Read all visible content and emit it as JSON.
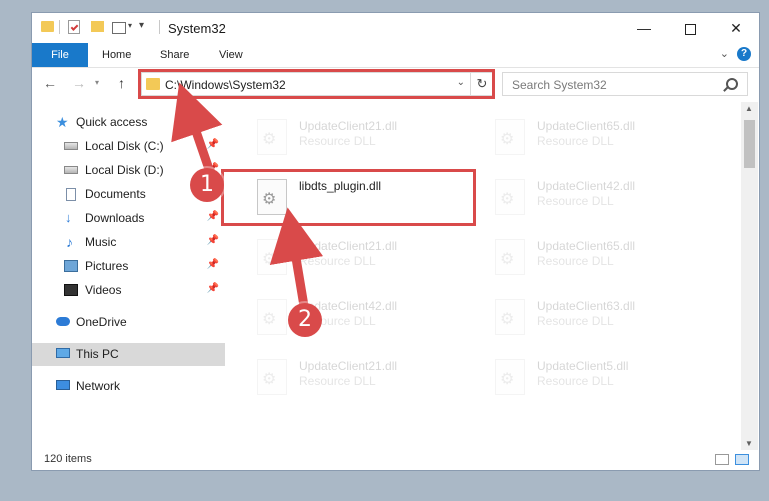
{
  "window": {
    "title": "System32"
  },
  "ribbon": {
    "file": "File",
    "home": "Home",
    "share": "Share",
    "view": "View"
  },
  "address": {
    "path": "C:\\Windows\\System32"
  },
  "search": {
    "placeholder": "Search System32"
  },
  "sidebar": {
    "items": [
      {
        "label": "Quick access",
        "icon": "star-icon",
        "pinned": false
      },
      {
        "label": "Local Disk (C:)",
        "icon": "drive-icon",
        "pinned": true
      },
      {
        "label": "Local Disk (D:)",
        "icon": "drive-icon",
        "pinned": true
      },
      {
        "label": "Documents",
        "icon": "documents-icon",
        "pinned": true
      },
      {
        "label": "Downloads",
        "icon": "downloads-icon",
        "pinned": true
      },
      {
        "label": "Music",
        "icon": "music-icon",
        "pinned": true
      },
      {
        "label": "Pictures",
        "icon": "pictures-icon",
        "pinned": true
      },
      {
        "label": "Videos",
        "icon": "videos-icon",
        "pinned": true
      },
      {
        "label": "OneDrive",
        "icon": "onedrive-icon",
        "pinned": false
      },
      {
        "label": "This PC",
        "icon": "this-pc-icon",
        "pinned": false,
        "selected": true
      },
      {
        "label": "Network",
        "icon": "network-icon",
        "pinned": false
      }
    ]
  },
  "files": {
    "left": [
      {
        "name": "UpdateClient21.dll",
        "type": "Resource DLL"
      },
      {
        "name": "libdts_plugin.dll",
        "type": ""
      },
      {
        "name": "UpdateClient21.dll",
        "type": "Resource DLL"
      },
      {
        "name": "UpdateClient42.dll",
        "type": "Resource DLL"
      },
      {
        "name": "UpdateClient21.dll",
        "type": "Resource DLL"
      }
    ],
    "right": [
      {
        "name": "UpdateClient65.dll",
        "type": "Resource DLL"
      },
      {
        "name": "UpdateClient42.dll",
        "type": "Resource DLL"
      },
      {
        "name": "UpdateClient65.dll",
        "type": "Resource DLL"
      },
      {
        "name": "UpdateClient63.dll",
        "type": "Resource DLL"
      },
      {
        "name": "UpdateClient5.dll",
        "type": "Resource DLL"
      }
    ]
  },
  "status": {
    "item_count": "120 items"
  },
  "callouts": {
    "step1": "1",
    "step2": "2"
  },
  "colors": {
    "accent": "#1979ca",
    "highlight": "#d94a4a"
  }
}
